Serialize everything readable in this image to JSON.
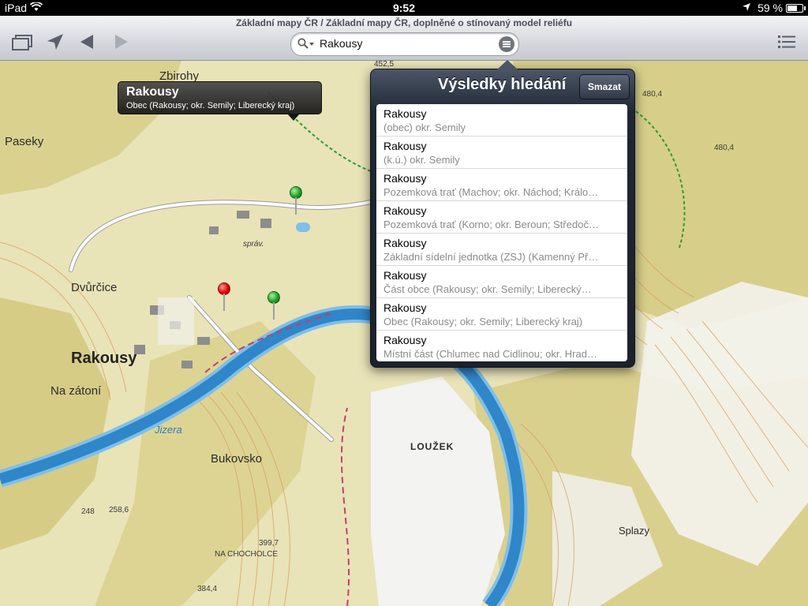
{
  "status_bar": {
    "carrier": "iPad",
    "time": "9:52",
    "battery_text": "59 %",
    "battery_level": 0.59
  },
  "toolbar": {
    "title": "Základní mapy ČR / Základní mapy ČR, doplněné o stínovaný model reliéfu",
    "search_query": "Rakousy",
    "icons": [
      "layers-icon",
      "location-arrow-icon",
      "back-arrow-icon",
      "forward-arrow-icon",
      "search-icon",
      "bookmarks-icon",
      "list-icon"
    ]
  },
  "callout": {
    "title": "Rakousy",
    "subtitle": "Obec  (Rakousy; okr. Semily; Liberecký kraj)"
  },
  "map_labels": {
    "zbirohy": "Zbirohy",
    "paseky": "Paseky",
    "dvurcice": "Dvůrčice",
    "rakousy": "Rakousy",
    "na_zatoni": "Na zátoní",
    "jizera": "Jizera",
    "bukovsko": "Bukovsko",
    "louzek": "LOUŽEK",
    "na_chocholce": "NA CHOCHOLCE",
    "splazy": "Splazy",
    "sprav": "správ.",
    "alt_4525": "452,5",
    "alt_4804a": "480,4",
    "alt_4804b": "480,4",
    "alt_2586": "258,6",
    "alt_248": "248",
    "alt_3997": "399,7",
    "alt_3844": "384,4"
  },
  "results_popover": {
    "title": "Výsledky hledání",
    "clear_button": "Smazat",
    "results": [
      {
        "name": "Rakousy",
        "detail": "(obec)  okr. Semily"
      },
      {
        "name": "Rakousy",
        "detail": "(k.ú.)  okr. Semily"
      },
      {
        "name": "Rakousy",
        "detail": "Pozemková trať  (Machov; okr. Náchod; Králo…"
      },
      {
        "name": "Rakousy",
        "detail": "Pozemková trať  (Korno; okr. Beroun; Středoč…"
      },
      {
        "name": "Rakousy",
        "detail": "Základní sídelní jednotka (ZSJ)  (Kamenný Př…"
      },
      {
        "name": "Rakousy",
        "detail": "Část obce  (Rakousy; okr. Semily; Liberecký…"
      },
      {
        "name": "Rakousy",
        "detail": "Obec  (Rakousy; okr. Semily; Liberecký kraj)"
      },
      {
        "name": "Rakousy",
        "detail": "Místní část  (Chlumec nad Cidlinou; okr. Hrad…"
      }
    ]
  },
  "colors": {
    "map_bg": "#e9e3b8",
    "forest": "#cfc67e",
    "river": "#2f86c8",
    "road": "#ffffff",
    "contour": "#d59a5a",
    "pin_red": "#e00000",
    "pin_green": "#1fa31f"
  }
}
